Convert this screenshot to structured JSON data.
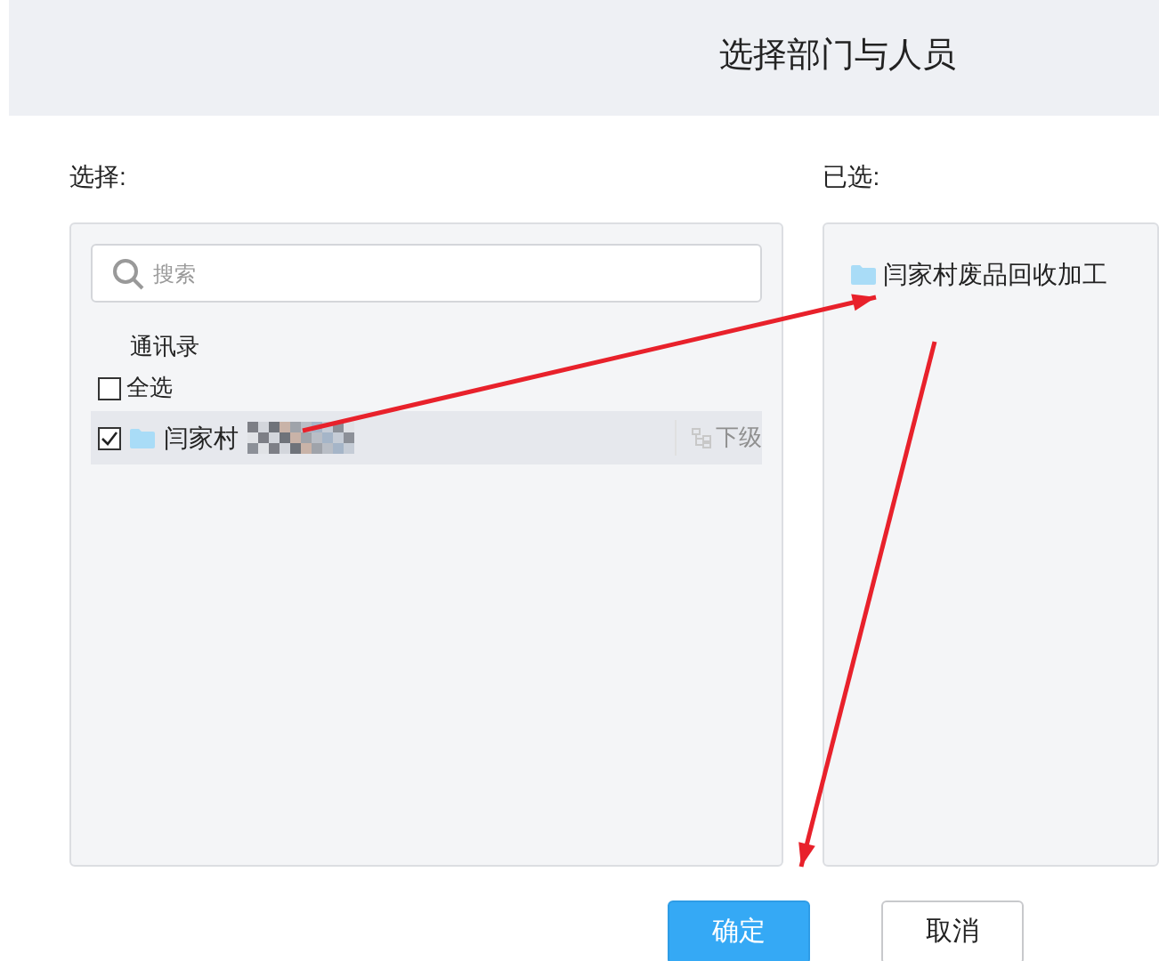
{
  "dialog": {
    "title": "选择部门与人员"
  },
  "left": {
    "label": "选择:",
    "search": {
      "placeholder": "搜索"
    },
    "breadcrumb": "通讯录",
    "select_all": {
      "label": "全选",
      "checked": false
    },
    "items": [
      {
        "name": "闫家村",
        "checked": true,
        "highlighted": true,
        "sub_label": "下级"
      }
    ]
  },
  "right": {
    "label": "已选:",
    "items": [
      {
        "name": "闫家村废品回收加工"
      }
    ]
  },
  "buttons": [
    {
      "label": "确定",
      "kind": "primary"
    },
    {
      "label": "取消",
      "kind": "secondary"
    }
  ]
}
